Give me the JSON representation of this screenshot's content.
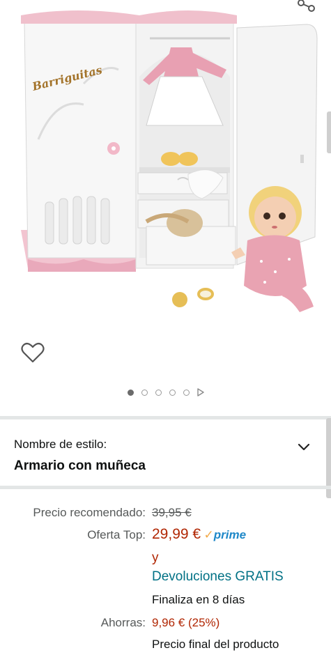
{
  "product": {
    "image_alt": "Armario de muñeca Barriguitas con muñeca, ropa y accesorios",
    "brand_on_image": "Barriguitas"
  },
  "icons": {
    "share": "share-icon",
    "wishlist": "heart-outline-icon",
    "expand": "chevron-down-icon",
    "carousel_next": "play-triangle-icon"
  },
  "carousel": {
    "count": 5,
    "active_index": 0
  },
  "style_selector": {
    "label": "Nombre de estilo:",
    "value": "Armario con muñeca"
  },
  "pricing": {
    "list_price_label": "Precio recomendado:",
    "list_price": "39,95 €",
    "deal_label": "Oferta Top:",
    "deal_price": "29,99 €",
    "prime_check": "✓",
    "prime_text": "prime",
    "and_text": "y",
    "returns_text": "Devoluciones GRATIS",
    "ends_text": "Finaliza en 8 días",
    "savings_label": "Ahorras:",
    "savings_value": "9,96 € (25%)",
    "final_price_text": "Precio final del producto"
  },
  "colors": {
    "price_red": "#b12704",
    "link_teal": "#007185",
    "prime_blue": "#1f88c8",
    "prime_orange": "#f3a847",
    "separator": "#e3e6e6"
  }
}
